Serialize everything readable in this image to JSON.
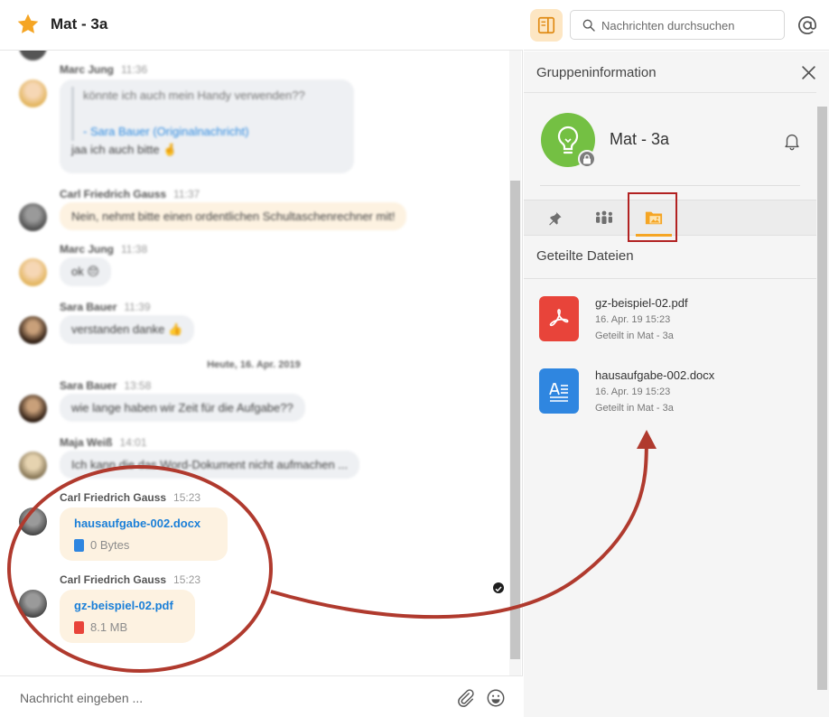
{
  "chat": {
    "title": "Mat - 3a",
    "messages": [
      {
        "sender": "Marc Jung",
        "time": "11:36",
        "quote": "könnte ich auch mein Handy verwenden??",
        "quote_ref_name": "- Sara Bauer",
        "quote_ref_link": "(Originalnachricht)",
        "text": "jaa ich auch bitte 🤞"
      },
      {
        "sender": "Carl Friedrich Gauss",
        "time": "11:37",
        "text": "Nein, nehmt bitte einen ordentlichen Schultaschenrechner mit!"
      },
      {
        "sender": "Marc Jung",
        "time": "11:38",
        "text": "ok 😔"
      },
      {
        "sender": "Sara Bauer",
        "time": "11:39",
        "text": "verstanden danke 👍"
      },
      {
        "sender": "Sara Bauer",
        "time": "13:58",
        "text": "wie lange haben wir Zeit für die Aufgabe??"
      },
      {
        "sender": "Maja Weiß",
        "time": "14:01",
        "text": "Ich kann die das Word-Dokument nicht aufmachen ..."
      }
    ],
    "date_separator": "Heute, 16. Apr. 2019",
    "file_messages": [
      {
        "sender": "Carl Friedrich Gauss",
        "time": "15:23",
        "file_name": "hausaufgabe-002.docx",
        "file_size": "0 Bytes",
        "icon": "docx-icon"
      },
      {
        "sender": "Carl Friedrich Gauss",
        "time": "15:23",
        "file_name": "gz-beispiel-02.pdf",
        "file_size": "8.1 MB",
        "icon": "pdf-icon"
      }
    ],
    "input_placeholder": "Nachricht eingeben ..."
  },
  "search": {
    "placeholder": "Nachrichten durchsuchen"
  },
  "panel": {
    "title": "Gruppeninformation",
    "group_name": "Mat - 3a",
    "tabs": [
      {
        "icon": "pin-icon"
      },
      {
        "icon": "members-icon"
      },
      {
        "icon": "files-icon",
        "active": true
      }
    ],
    "files_heading": "Geteilte Dateien",
    "shared_files": [
      {
        "name": "gz-beispiel-02.pdf",
        "date": "16. Apr. 19 15:23",
        "shared_in": "Geteilt in Mat - 3a",
        "icon": "pdf-icon"
      },
      {
        "name": "hausaufgabe-002.docx",
        "date": "16. Apr. 19 15:23",
        "shared_in": "Geteilt in Mat - 3a",
        "icon": "docx-icon"
      }
    ]
  },
  "colors": {
    "accent": "#f5a524",
    "link": "#1a7fd8",
    "pdf": "#e8443a",
    "docx": "#2f86e0",
    "group": "#74c043",
    "annotation": "#b03a2e"
  }
}
